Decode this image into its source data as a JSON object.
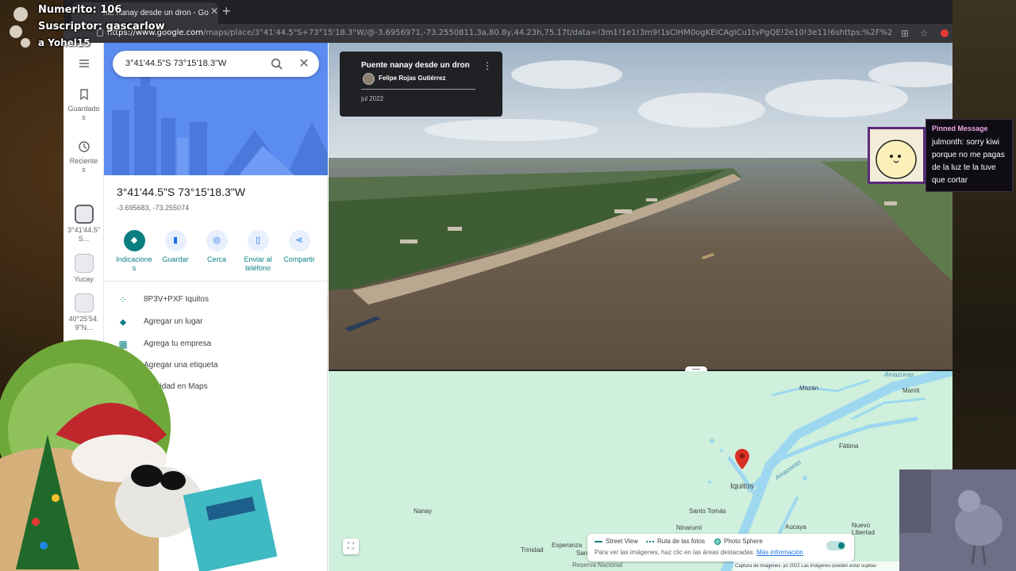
{
  "browser": {
    "tab_title": "nte nanay desde un dron - Go",
    "url_host": "https://www.google.com",
    "url_path": "/maps/place/3°41'44.5\"S+73°15'18.3\"W/@-3.6956971,-73.2550811,3a,80.8y,44.23h,75.17t/data=!3m1!1e1!3m9!1sCIHM0ogKEICAgICu1tvPgQE!2e10!3e11!6shttps:%2F%2Flh3.googleusercontent.com%2"
  },
  "rail": {
    "items": [
      {
        "label": "Guardado\ns",
        "icon": "bookmark-icon"
      },
      {
        "label": "Reciente\ns",
        "icon": "history-icon"
      },
      {
        "label": "3°41'44.5\"\nS...",
        "icon": "place-thumb"
      },
      {
        "label": "Yucay",
        "icon": "place-thumb"
      },
      {
        "label": "40°25'54.\n9\"N...",
        "icon": "place-thumb"
      }
    ]
  },
  "search": {
    "value": "3°41'44.5\"S 73°15'18.3\"W"
  },
  "place": {
    "title": "3°41'44.5\"S 73°15'18.3\"W",
    "coords": "-3.695683, -73.255074"
  },
  "actions": [
    {
      "label": "Indicacione\ns",
      "icon": "directions-icon"
    },
    {
      "label": "Guardar",
      "icon": "bookmark-icon"
    },
    {
      "label": "Cerca",
      "icon": "nearby-icon"
    },
    {
      "label": "Enviar al\nteléfono",
      "icon": "phone-icon"
    },
    {
      "label": "Compartir",
      "icon": "share-icon"
    }
  ],
  "rows": [
    {
      "label": "8P3V+PXF Iquitos",
      "icon": "plus-code-icon"
    },
    {
      "label": "Agregar un lugar",
      "icon": "add-place-icon"
    },
    {
      "label": "Agrega tu empresa",
      "icon": "business-icon"
    },
    {
      "label": "Agregar una etiqueta",
      "icon": "label-icon"
    },
    {
      "label": "actividad en Maps",
      "icon": "activity-icon"
    }
  ],
  "photo_card": {
    "title": "Puente nanay desde un dron",
    "author": "Felipe Rojas Gutiérrez",
    "date": "jul 2022"
  },
  "map": {
    "labels": {
      "amazonas_top": "Amazonas",
      "mazan": "Mazán",
      "maniti": "Maniti",
      "fatima": "Fátima",
      "iquitos": "Iquitos",
      "amazonas_mid": "Amazonas",
      "nanay": "Nanay",
      "santo_tomas": "Santo Tomás",
      "narinumi": "Ninarumi",
      "aucaya": "Aucaya",
      "nuevo_libertad": "Nuevo\nLibertad",
      "trinidad": "Trinidad",
      "esperanza": "Esperanza",
      "san_lu": "San Lu",
      "reserva": "Reserva Nacional"
    },
    "legend": {
      "street_view": "Street View",
      "photo_path": "Ruta de las fotos",
      "photo_sphere": "Photo Sphere",
      "note": "Para ver las imágenes, haz clic en las áreas destacadas.",
      "more_info": "Más información"
    },
    "attribution": "Captura de imágenes: jul 2022      Las imágenes pueden estar sujetas",
    "colors": {
      "water": "#9ed8f0",
      "land": "#cff0dc",
      "pin": "#d93025"
    }
  },
  "stream": {
    "numerito": "Numerito: 106",
    "suscriptor": "Suscriptor: gascarlow",
    "follower": "a   Yohel15",
    "pinned_header": "Pinned Message",
    "pinned_text": "julmonth: sorry kiwi porque no me pagas de la luz te la tuve que cortar"
  }
}
